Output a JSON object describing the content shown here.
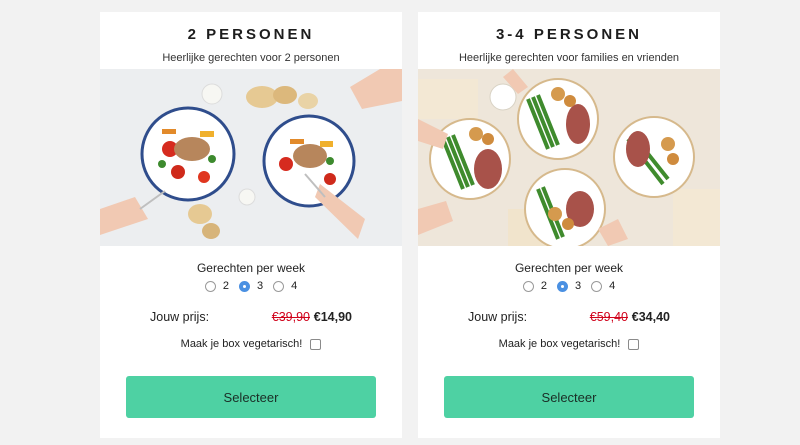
{
  "plans": [
    {
      "title": "2 PERSONEN",
      "subtitle": "Heerlijke gerechten voor 2 personen",
      "per_week_label": "Gerechten per week",
      "options": [
        "2",
        "3",
        "4"
      ],
      "selected_option": "3",
      "price_label": "Jouw prijs:",
      "old_price": "€39,90",
      "new_price": "€14,90",
      "vegetarian_label": "Maak je box vegetarisch!",
      "button_label": "Selecteer"
    },
    {
      "title": "3-4 PERSONEN",
      "subtitle": "Heerlijke gerechten voor families en vrienden",
      "per_week_label": "Gerechten per week",
      "options": [
        "2",
        "3",
        "4"
      ],
      "selected_option": "3",
      "price_label": "Jouw prijs:",
      "old_price": "€59,40",
      "new_price": "€34,40",
      "vegetarian_label": "Maak je box vegetarisch!",
      "button_label": "Selecteer"
    }
  ],
  "colors": {
    "background": "#f2f2f2",
    "button": "#4ed1a3",
    "old_price": "#d0021b",
    "radio_selected": "#4a90e2"
  }
}
